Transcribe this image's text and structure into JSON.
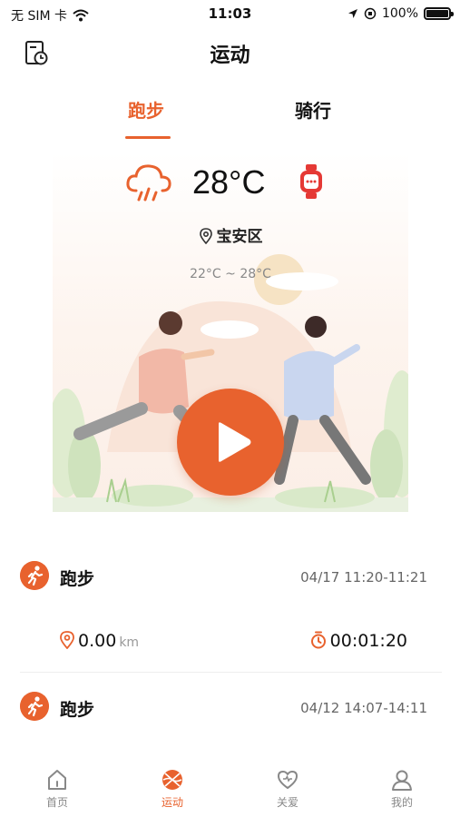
{
  "status_bar": {
    "carrier": "无 SIM 卡",
    "time": "11:03",
    "battery": "100%"
  },
  "header": {
    "title": "运动",
    "history_icon": "history-icon"
  },
  "tabs": [
    {
      "label": "跑步",
      "active": true
    },
    {
      "label": "骑行",
      "active": false
    }
  ],
  "weather": {
    "icon": "rain-cloud-icon",
    "temperature": "28°C",
    "location": "宝安区",
    "range": "22°C ~ 28°C"
  },
  "records": [
    {
      "type": "跑步",
      "time": "04/17 11:20-11:21",
      "distance": "0.00",
      "distance_unit": "km",
      "duration": "00:01:20"
    },
    {
      "type": "跑步",
      "time": "04/12 14:07-14:11"
    }
  ],
  "tabbar": [
    {
      "label": "首页",
      "icon": "home-icon",
      "active": false
    },
    {
      "label": "运动",
      "icon": "sport-icon",
      "active": true
    },
    {
      "label": "关爱",
      "icon": "heart-icon",
      "active": false
    },
    {
      "label": "我的",
      "icon": "profile-icon",
      "active": false
    }
  ],
  "colors": {
    "accent": "#e8622e",
    "text": "#111111",
    "muted": "#888888"
  }
}
